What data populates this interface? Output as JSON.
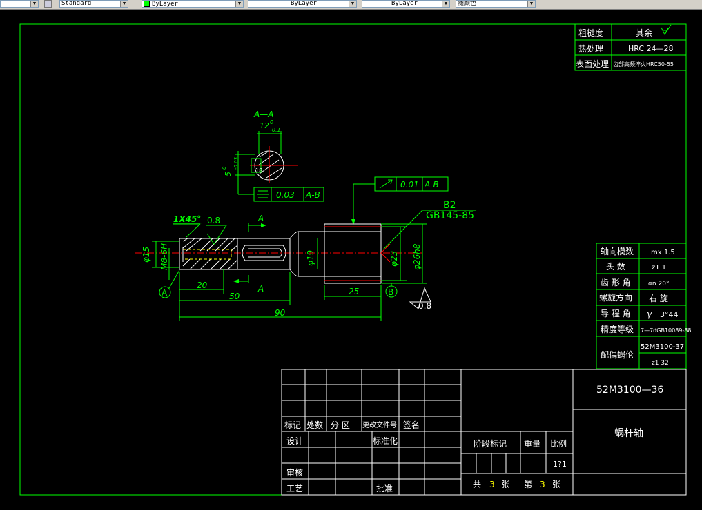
{
  "toolbar": {
    "text_style": "Standard",
    "layer": "ByLayer",
    "linetype": "ByLayer",
    "lineweight": "ByLayer",
    "plot_color": "随颜色"
  },
  "colors": {
    "background": "#000000",
    "drawing": "#00ff00",
    "frame": "#ffffff",
    "centerline": "#ff0000",
    "hidden": "#ffff00"
  },
  "top_table": {
    "roughness_label": "粗糙度",
    "roughness_value": "其余",
    "heat_label": "热处理",
    "heat_value": "HRC  24—28",
    "surface_label": "表面处理",
    "surface_value": "齿部高频淬火HRC50-55"
  },
  "worm_table": {
    "module_label": "轴向模数",
    "module_value": "mx  1.5",
    "heads_label": "头  数",
    "heads_value": "z1   1",
    "angle_label": "齿 形 角",
    "angle_value": "αn    20°",
    "direction_label": "螺旋方向",
    "direction_value": "右  旋",
    "lead_label": "导 程 角",
    "lead_value": "3°44",
    "lead_symbol": "γ",
    "precision_label": "精度等级",
    "precision_value": "7—7dGB10089-88",
    "mate_label": "配偶蜗伦",
    "mate_value": "52M3100-37",
    "mate_z": "z1    32"
  },
  "drawing": {
    "section_label": "A—A",
    "section_width": "12",
    "section_width_tol_upper": "0",
    "section_width_tol_lower": "-0.1",
    "section_depth": "5",
    "section_depth_tol_upper": "0",
    "section_depth_tol_lower": "-0.03",
    "section_inner": "18",
    "sym_tol": "0.03",
    "sym_ref": "A-B",
    "runout_tol": "0.01",
    "runout_ref": "A-B",
    "chamfer": "1X45°",
    "rough_1": "0.8",
    "rough_2": "0.8",
    "center_hole": "B2",
    "center_std": "GB145-85",
    "cut_a": "A",
    "dia_15": "φ15",
    "thread": "M8-6H",
    "dia_19": "φ19",
    "dia_23": "φ23",
    "dia_26": "φ26h8",
    "dim_20": "20",
    "dim_50": "50",
    "dim_90": "90",
    "dim_25": "25",
    "datum_a": "A",
    "datum_b": "B"
  },
  "title_block": {
    "rev_mark": "标记",
    "rev_count": "处数",
    "rev_zone": "分    区",
    "rev_doc": "更改文件号",
    "rev_sign": "签名",
    "design": "设计",
    "standardize": "标准化",
    "review": "审核",
    "process": "工艺",
    "approve": "批准",
    "stage": "阶段标记",
    "weight": "重量",
    "scale_label": "比例",
    "scale_value": "1?1",
    "total_pre": "共",
    "total_num": "3",
    "sheet_unit": "张",
    "sheet_pre": "第",
    "sheet_num": "3",
    "drawing_no": "52M3100—36",
    "part_name": "蜗杆轴"
  }
}
